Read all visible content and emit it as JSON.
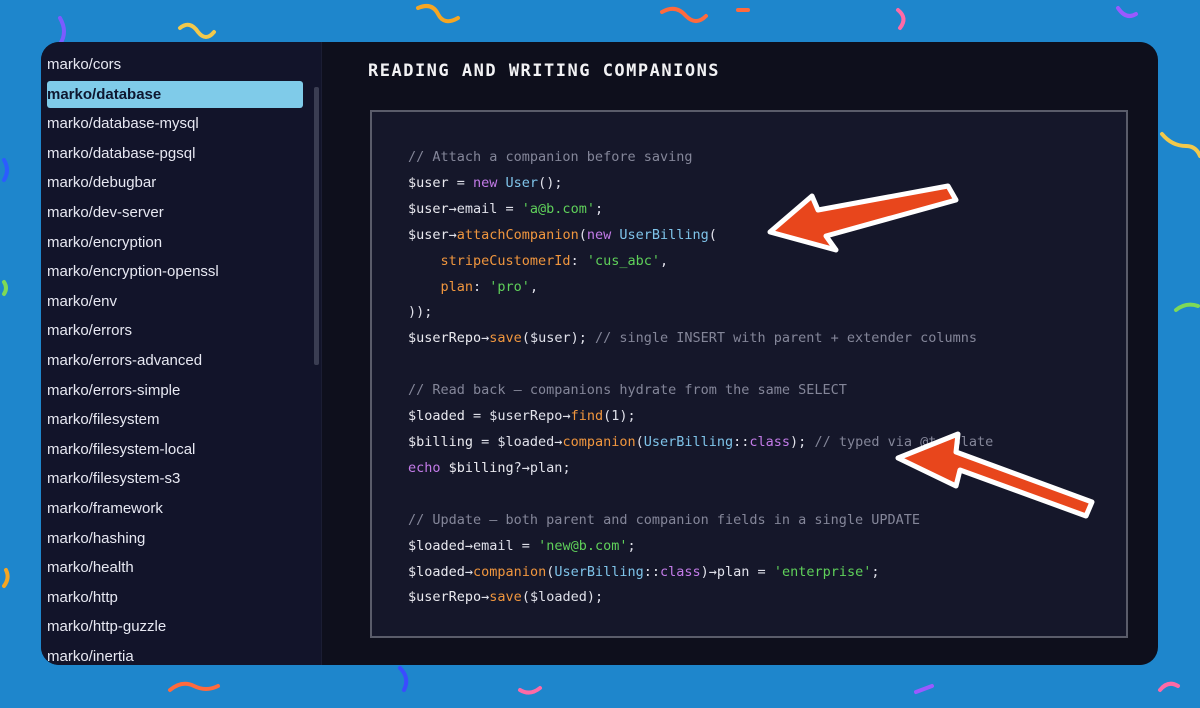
{
  "sidebar": {
    "items": [
      {
        "label": "marko/cors",
        "active": false
      },
      {
        "label": "marko/database",
        "active": true
      },
      {
        "label": "marko/database-mysql",
        "active": false
      },
      {
        "label": "marko/database-pgsql",
        "active": false
      },
      {
        "label": "marko/debugbar",
        "active": false
      },
      {
        "label": "marko/dev-server",
        "active": false
      },
      {
        "label": "marko/encryption",
        "active": false
      },
      {
        "label": "marko/encryption-openssl",
        "active": false
      },
      {
        "label": "marko/env",
        "active": false
      },
      {
        "label": "marko/errors",
        "active": false
      },
      {
        "label": "marko/errors-advanced",
        "active": false
      },
      {
        "label": "marko/errors-simple",
        "active": false
      },
      {
        "label": "marko/filesystem",
        "active": false
      },
      {
        "label": "marko/filesystem-local",
        "active": false
      },
      {
        "label": "marko/filesystem-s3",
        "active": false
      },
      {
        "label": "marko/framework",
        "active": false
      },
      {
        "label": "marko/hashing",
        "active": false
      },
      {
        "label": "marko/health",
        "active": false
      },
      {
        "label": "marko/http",
        "active": false
      },
      {
        "label": "marko/http-guzzle",
        "active": false
      },
      {
        "label": "marko/inertia",
        "active": false
      }
    ]
  },
  "content": {
    "title": "READING AND WRITING COMPANIONS",
    "code_lines": [
      [
        [
          "com",
          "// Attach a companion before saving"
        ]
      ],
      [
        [
          "var",
          "$user"
        ],
        [
          "op",
          " = "
        ],
        [
          "kw",
          "new "
        ],
        [
          "cls",
          "User"
        ],
        [
          "op",
          "();"
        ]
      ],
      [
        [
          "var",
          "$user"
        ],
        [
          "op",
          "→email = "
        ],
        [
          "str",
          "'a@b.com'"
        ],
        [
          "op",
          ";"
        ]
      ],
      [
        [
          "var",
          "$user"
        ],
        [
          "op",
          "→"
        ],
        [
          "fn",
          "attachCompanion"
        ],
        [
          "op",
          "("
        ],
        [
          "kw",
          "new "
        ],
        [
          "cls",
          "UserBilling"
        ],
        [
          "op",
          "("
        ]
      ],
      [
        [
          "op",
          "    "
        ],
        [
          "prop",
          "stripeCustomerId"
        ],
        [
          "op",
          ": "
        ],
        [
          "str",
          "'cus_abc'"
        ],
        [
          "op",
          ","
        ]
      ],
      [
        [
          "op",
          "    "
        ],
        [
          "prop",
          "plan"
        ],
        [
          "op",
          ": "
        ],
        [
          "str",
          "'pro'"
        ],
        [
          "op",
          ","
        ]
      ],
      [
        [
          "op",
          "));"
        ]
      ],
      [
        [
          "var",
          "$userRepo"
        ],
        [
          "op",
          "→"
        ],
        [
          "fn",
          "save"
        ],
        [
          "op",
          "($user); "
        ],
        [
          "com",
          "// single INSERT with parent + extender columns"
        ]
      ],
      [],
      [
        [
          "com",
          "// Read back — companions hydrate from the same SELECT"
        ]
      ],
      [
        [
          "var",
          "$loaded"
        ],
        [
          "op",
          " = $userRepo→"
        ],
        [
          "fn",
          "find"
        ],
        [
          "op",
          "(1);"
        ]
      ],
      [
        [
          "var",
          "$billing"
        ],
        [
          "op",
          " = $loaded→"
        ],
        [
          "fn",
          "companion"
        ],
        [
          "op",
          "("
        ],
        [
          "cls",
          "UserBilling"
        ],
        [
          "op",
          "::"
        ],
        [
          "kw",
          "class"
        ],
        [
          "op",
          "); "
        ],
        [
          "com",
          "// typed via @template"
        ]
      ],
      [
        [
          "kw",
          "echo "
        ],
        [
          "var",
          "$billing"
        ],
        [
          "op",
          "?→plan;"
        ]
      ],
      [],
      [
        [
          "com",
          "// Update — both parent and companion fields in a single UPDATE"
        ]
      ],
      [
        [
          "var",
          "$loaded"
        ],
        [
          "op",
          "→email = "
        ],
        [
          "str",
          "'new@b.com'"
        ],
        [
          "op",
          ";"
        ]
      ],
      [
        [
          "var",
          "$loaded"
        ],
        [
          "op",
          "→"
        ],
        [
          "fn",
          "companion"
        ],
        [
          "op",
          "("
        ],
        [
          "cls",
          "UserBilling"
        ],
        [
          "op",
          "::"
        ],
        [
          "kw",
          "class"
        ],
        [
          "op",
          ")→plan = "
        ],
        [
          "str",
          "'enterprise'"
        ],
        [
          "op",
          ";"
        ]
      ],
      [
        [
          "var",
          "$userRepo"
        ],
        [
          "op",
          "→"
        ],
        [
          "fn",
          "save"
        ],
        [
          "op",
          "($loaded);"
        ]
      ]
    ]
  },
  "colors": {
    "background": "#1e86cc",
    "active_item": "#7fcbe9",
    "arrow": "#e8461c"
  },
  "icons": [
    "annotation-arrow-icon"
  ]
}
